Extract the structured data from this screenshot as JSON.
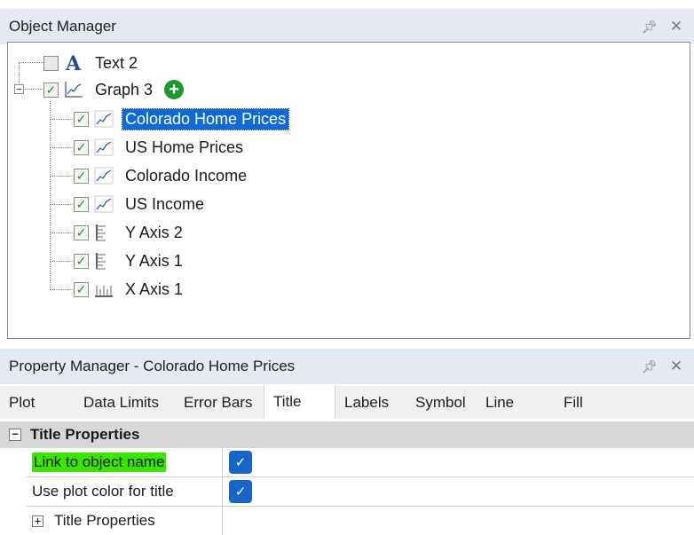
{
  "object_manager": {
    "title": "Object Manager",
    "pin_icon": "pin-icon",
    "close_icon": "close-icon",
    "tree": [
      {
        "label": "Text 2",
        "icon": "text-icon",
        "checked": false
      },
      {
        "label": "Graph 3",
        "icon": "graph-icon",
        "checked": true,
        "expander": "−"
      },
      {
        "label": "Colorado Home Prices",
        "icon": "line-plot-icon",
        "checked": true,
        "selected": true
      },
      {
        "label": "US Home Prices",
        "icon": "line-plot-icon",
        "checked": true
      },
      {
        "label": "Colorado Income",
        "icon": "line-plot-icon",
        "checked": true
      },
      {
        "label": "US Income",
        "icon": "line-plot-icon",
        "checked": true
      },
      {
        "label": "Y Axis 2",
        "icon": "y-axis-icon",
        "checked": true
      },
      {
        "label": "Y Axis 1",
        "icon": "y-axis-icon",
        "checked": true
      },
      {
        "label": "X Axis 1",
        "icon": "x-axis-icon",
        "checked": true
      }
    ],
    "add_icon": "plus-circle-icon"
  },
  "property_manager": {
    "title": "Property Manager - Colorado Home Prices",
    "tabs": [
      "Plot",
      "Data Limits",
      "Error Bars",
      "Title",
      "Labels",
      "Symbol",
      "Line",
      "Fill"
    ],
    "active_tab": "Title",
    "section": {
      "label": "Title Properties",
      "toggle": "−"
    },
    "rows": [
      {
        "name": "Link to object name",
        "checked": true,
        "highlight": true
      },
      {
        "name": "Use plot color for title",
        "checked": true
      },
      {
        "name": "Title Properties",
        "toggle": "+"
      }
    ]
  },
  "colors": {
    "header_bg": "#e4e9f2",
    "selection": "#0f6ad7",
    "checkbox_blue": "#1765c9",
    "highlight_green": "#39e600",
    "add_green": "#1b9b2e"
  }
}
